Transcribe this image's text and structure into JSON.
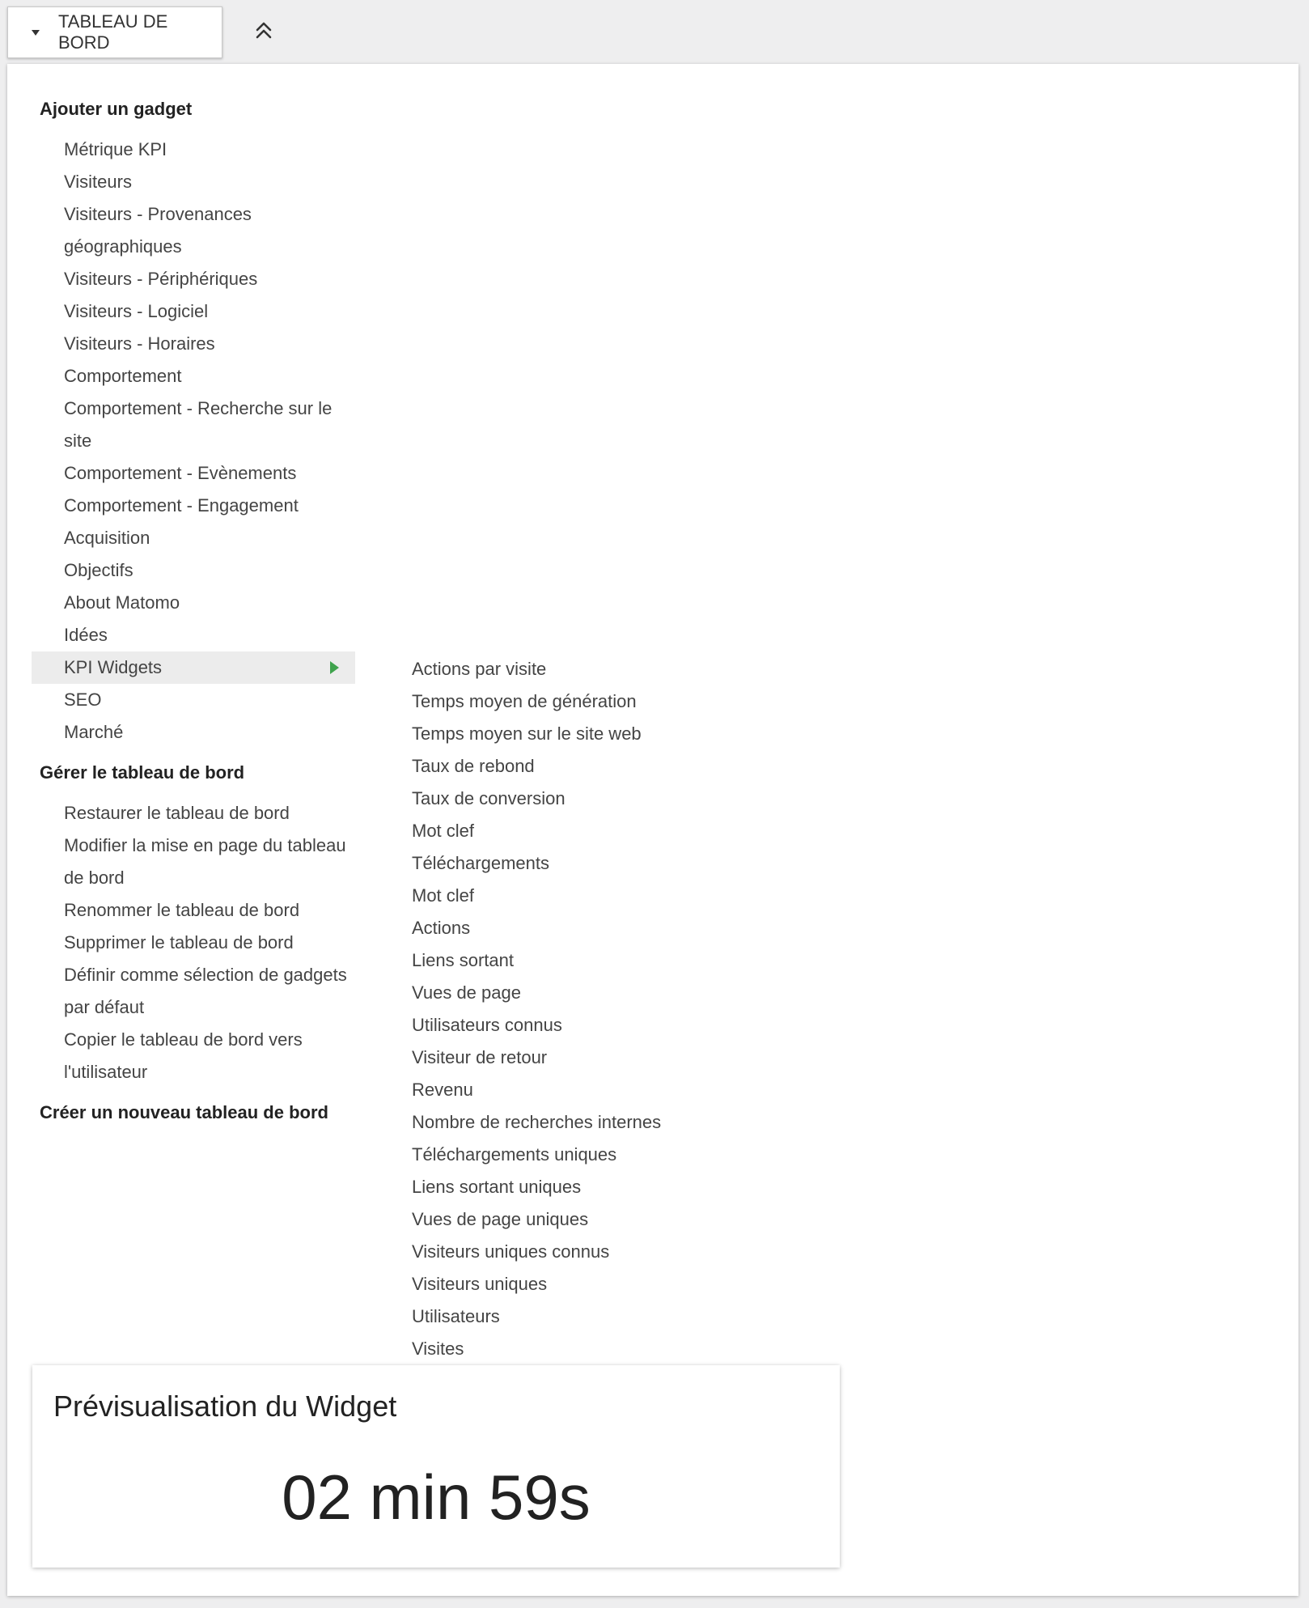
{
  "topbar": {
    "dashboard_label": "TABLEAU DE BORD",
    "caret_icon": "caret-down-icon",
    "collapse_icon": "chevron-double-up-icon"
  },
  "add_gadget": {
    "title": "Ajouter un gadget",
    "items": [
      {
        "label": "Métrique KPI"
      },
      {
        "label": "Visiteurs"
      },
      {
        "label": "Visiteurs - Provenances géographiques"
      },
      {
        "label": "Visiteurs - Périphériques"
      },
      {
        "label": "Visiteurs - Logiciel"
      },
      {
        "label": "Visiteurs - Horaires"
      },
      {
        "label": "Comportement"
      },
      {
        "label": "Comportement - Recherche sur le site"
      },
      {
        "label": "Comportement - Evènements"
      },
      {
        "label": "Comportement - Engagement"
      },
      {
        "label": "Acquisition"
      },
      {
        "label": "Objectifs"
      },
      {
        "label": "About Matomo"
      },
      {
        "label": "Idées"
      },
      {
        "label": "KPI Widgets"
      },
      {
        "label": "SEO"
      },
      {
        "label": "Marché"
      }
    ],
    "selected_index": 14
  },
  "manage_dashboard": {
    "title": "Gérer le tableau de bord",
    "items": [
      {
        "label": "Restaurer le tableau de bord"
      },
      {
        "label": "Modifier la mise en page du tableau de bord"
      },
      {
        "label": "Renommer le tableau de bord"
      },
      {
        "label": "Supprimer le tableau de bord"
      },
      {
        "label": "Définir comme sélection de gadgets par défaut"
      },
      {
        "label": "Copier le tableau de bord vers l'utilisateur"
      }
    ]
  },
  "create_dashboard": {
    "title": "Créer un nouveau tableau de bord"
  },
  "kpi_widgets": {
    "items": [
      {
        "label": "Actions par visite"
      },
      {
        "label": "Temps moyen de génération"
      },
      {
        "label": "Temps moyen sur le site web"
      },
      {
        "label": "Taux de rebond"
      },
      {
        "label": "Taux de conversion"
      },
      {
        "label": "Mot clef"
      },
      {
        "label": "Téléchargements"
      },
      {
        "label": "Mot clef"
      },
      {
        "label": "Actions"
      },
      {
        "label": "Liens sortant"
      },
      {
        "label": "Vues de page"
      },
      {
        "label": "Utilisateurs connus"
      },
      {
        "label": "Visiteur de retour"
      },
      {
        "label": "Revenu"
      },
      {
        "label": "Nombre de recherches internes"
      },
      {
        "label": "Téléchargements uniques"
      },
      {
        "label": "Liens sortant uniques"
      },
      {
        "label": "Vues de page uniques"
      },
      {
        "label": "Visiteurs uniques connus"
      },
      {
        "label": "Visiteurs uniques"
      },
      {
        "label": "Utilisateurs"
      },
      {
        "label": "Visites"
      }
    ]
  },
  "preview": {
    "title": "Prévisualisation du Widget",
    "value": "02 min 59s"
  },
  "colors": {
    "accent_arrow": "#3fa34d",
    "selected_bg": "#ececec",
    "page_bg": "#eeeeef"
  }
}
